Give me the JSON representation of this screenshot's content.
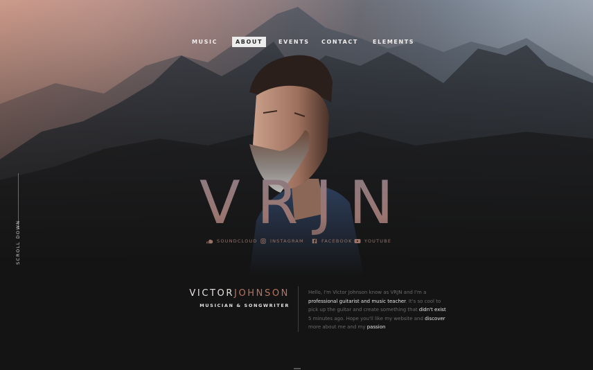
{
  "nav": {
    "items": [
      {
        "label": "MUSIC",
        "active": false
      },
      {
        "label": "ABOUT",
        "active": true
      },
      {
        "label": "EVENTS",
        "active": false
      },
      {
        "label": "CONTACT",
        "active": false
      },
      {
        "label": "ELEMENTS",
        "active": false
      }
    ]
  },
  "hero": {
    "title": "VRJN"
  },
  "social": [
    {
      "label": "SOUNDCLOUD",
      "icon": "soundcloud-icon"
    },
    {
      "label": "INSTAGRAM",
      "icon": "instagram-icon"
    },
    {
      "label": "FACEBOOK",
      "icon": "facebook-icon"
    },
    {
      "label": "YOUTUBE",
      "icon": "youtube-icon"
    }
  ],
  "scroll_label": "SCROLL DOWN",
  "profile": {
    "first_name": "VICTOR",
    "last_name": "JOHNSON",
    "role": "MUSICIAN & SONGWRITER",
    "bio": [
      {
        "text": "Hello, I'm Victor Johnson know as VRJN and I'm a ",
        "hl": false
      },
      {
        "text": "professional guitarist and music teacher",
        "hl": true
      },
      {
        "text": ". It's so cool to pick up the guitar and create something that ",
        "hl": false
      },
      {
        "text": "didn't exist",
        "hl": true
      },
      {
        "text": " 5 minutes ago. Hope you'll like my website and ",
        "hl": false
      },
      {
        "text": "discover",
        "hl": true
      },
      {
        "text": " more about me and my ",
        "hl": false
      },
      {
        "text": "passion",
        "hl": true
      }
    ]
  },
  "colors": {
    "accent": "#b8765f",
    "background": "#141414",
    "sky_left": "#c49586",
    "sky_right": "#a7afba"
  }
}
